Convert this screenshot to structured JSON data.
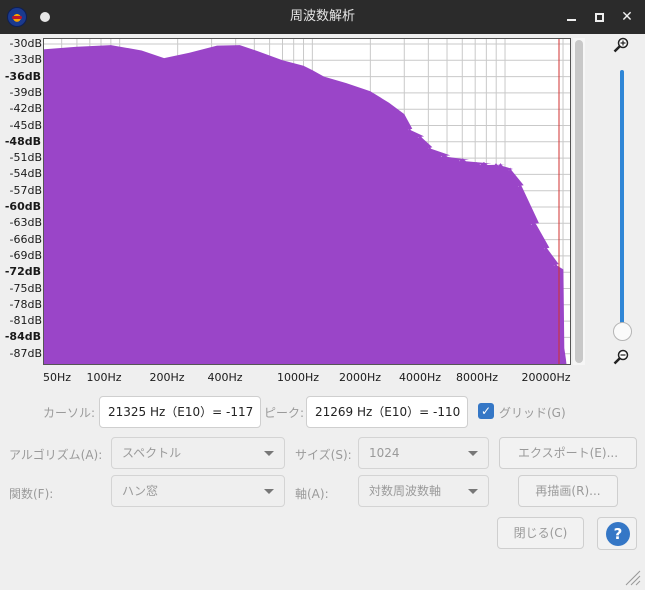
{
  "window": {
    "title": "周波数解析"
  },
  "yaxis": {
    "labels": [
      "-30dB",
      "-33dB",
      "-36dB",
      "-39dB",
      "-42dB",
      "-45dB",
      "-48dB",
      "-51dB",
      "-54dB",
      "-57dB",
      "-60dB",
      "-63dB",
      "-66dB",
      "-69dB",
      "-72dB",
      "-75dB",
      "-78dB",
      "-81dB",
      "-84dB",
      "-87dB"
    ]
  },
  "xaxis": {
    "labels": [
      "50Hz",
      "100Hz",
      "200Hz",
      "400Hz",
      "1000Hz",
      "2000Hz",
      "4000Hz",
      "8000Hz",
      "20000Hz"
    ]
  },
  "colors": {
    "spectrum": "#9a45c8",
    "grid": "#c9c9c9",
    "accent": "#3577c6"
  },
  "controls": {
    "cursor_label": "カーソル:",
    "cursor_value": "21325 Hz（E10）= -117",
    "peak_label": "ピーク:",
    "peak_value": "21269 Hz（E10）= -110",
    "grid_label": "グリッド(G)",
    "algorithm_label": "アルゴリズム(A):",
    "algorithm_value": "スペクトル",
    "size_label": "サイズ(S):",
    "size_value": "1024",
    "export_label": "エクスポート(E)...",
    "function_label": "関数(F):",
    "function_value": "ハン窓",
    "axis_label": "軸(A):",
    "axis_value": "対数周波数軸",
    "replot_label": "再描画(R)...",
    "close_label": "閉じる(C)",
    "help_label": "?"
  }
}
